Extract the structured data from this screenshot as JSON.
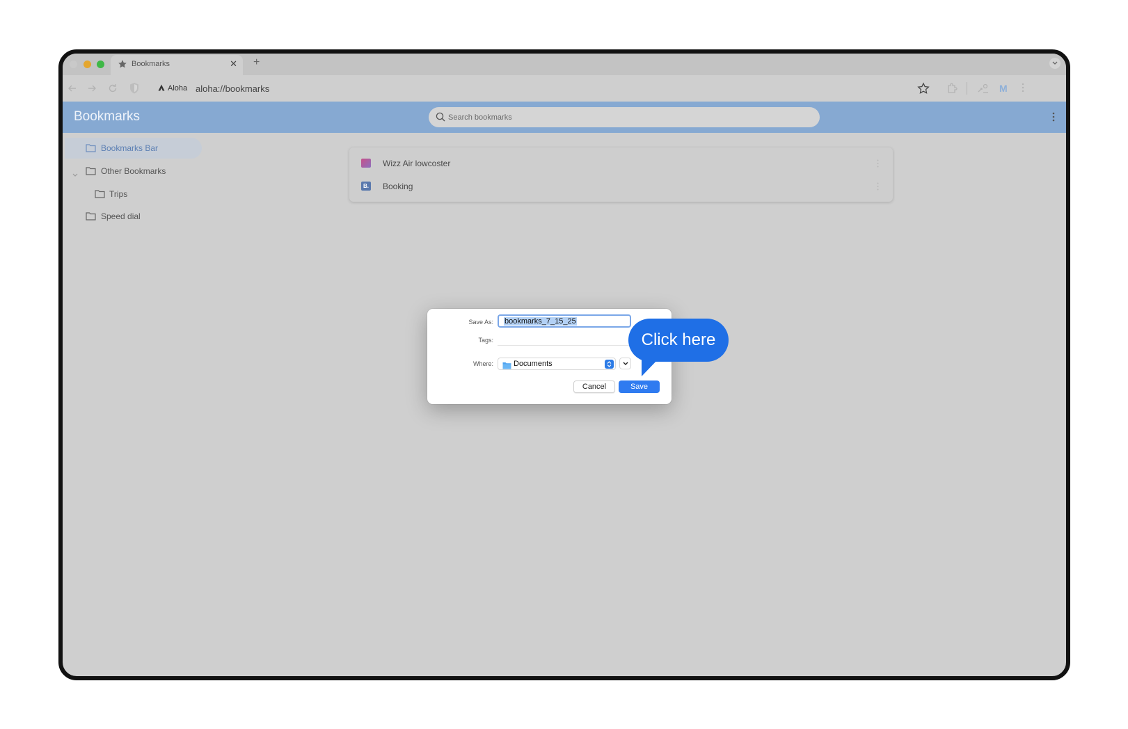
{
  "tab": {
    "title": "Bookmarks",
    "close_glyph": "✕",
    "new_tab_glyph": "+",
    "icon": "star-icon"
  },
  "toolbar": {
    "address_chip_label": "Aloha",
    "url": "aloha://bookmarks",
    "profile_initial": "M"
  },
  "header": {
    "title": "Bookmarks",
    "search_placeholder": "Search bookmarks"
  },
  "sidebar": {
    "items": [
      {
        "label": "Bookmarks Bar",
        "selected": true
      },
      {
        "label": "Other Bookmarks",
        "expanded": true
      },
      {
        "label": "Trips"
      },
      {
        "label": "Speed dial"
      }
    ]
  },
  "bookmarks": [
    {
      "label": "Wizz Air lowcoster",
      "favicon": "wizz-air-favicon"
    },
    {
      "label": "Booking",
      "favicon": "booking-favicon",
      "favicon_text": "B."
    }
  ],
  "save_dialog": {
    "save_as_label": "Save As:",
    "save_as_value": "bookmarks_7_15_25",
    "tags_label": "Tags:",
    "tags_value": "",
    "where_label": "Where:",
    "where_value": "Documents",
    "cancel_label": "Cancel",
    "save_label": "Save"
  },
  "callout": {
    "text": "Click here"
  },
  "colors": {
    "header_bg": "#86a9d2",
    "accent_blue": "#2f7bf0",
    "callout_blue": "#1f6fe6",
    "dim_bg": "#cfcfcf"
  }
}
